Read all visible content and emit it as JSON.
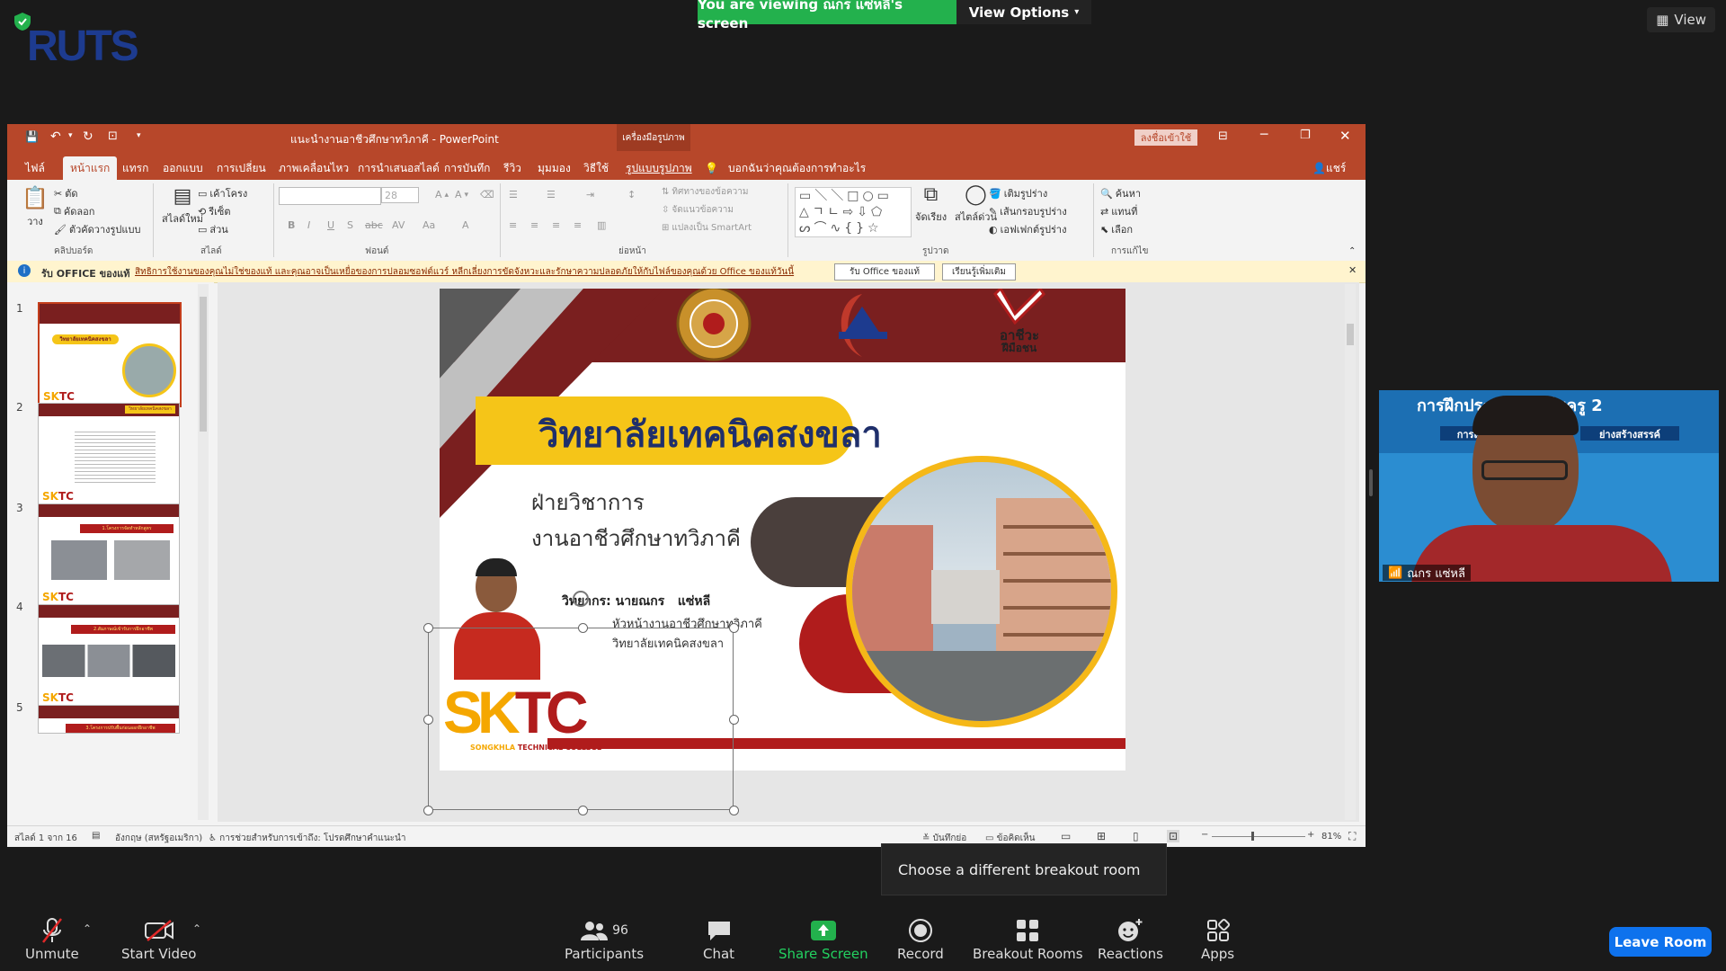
{
  "zoom": {
    "banner": "You are viewing ณกร แซ่หลี่'s screen",
    "view_options": "View Options",
    "view": "View",
    "tooltip": "Choose a different breakout room",
    "leave": "Leave Room",
    "toolbar": {
      "unmute": "Unmute",
      "start_video": "Start Video",
      "participants": "Participants",
      "participants_count": "96",
      "chat": "Chat",
      "share_screen": "Share Screen",
      "record": "Record",
      "breakout_rooms": "Breakout Rooms",
      "reactions": "Reactions",
      "apps": "Apps"
    },
    "video": {
      "name": "ณกร แซ่หลี",
      "banner_title": "การฝึกประ... วิชาชีพครู 2",
      "banner_sub1": "การแล",
      "banner_sub2": "ย่างสร้างสรรค์"
    },
    "logo_text": "RUTS"
  },
  "ppt": {
    "title": "แนะนำงานอาชีวศึกษาทวิภาคี - PowerPoint",
    "context_label": "เครื่องมือรูปภาพ",
    "signin": "ลงชื่อเข้าใช้",
    "tabs": [
      "ไฟล์",
      "หน้าแรก",
      "แทรก",
      "ออกแบบ",
      "การเปลี่ยน",
      "ภาพเคลื่อนไหว",
      "การนำเสนอสไลด์",
      "การบันทึก",
      "รีวิว",
      "มุมมอง",
      "วิธีใช้",
      "รูปแบบรูปภาพ"
    ],
    "tell_me": "บอกฉันว่าคุณต้องการทำอะไร",
    "share": "แชร์",
    "ribbon": {
      "paste": "วาง",
      "cut": "ตัด",
      "copy": "คัดลอก",
      "format_painter": "ตัวคัดวางรูปแบบ",
      "clipboard": "คลิปบอร์ด",
      "new_slide": "สไลด์ใหม่",
      "layout": "เค้าโครง",
      "reset": "รีเซ็ต",
      "section": "ส่วน",
      "slides": "สไลด์",
      "font_size": "28",
      "font": "ฟอนต์",
      "text_direction": "ทิศทางของข้อความ",
      "align_text": "จัดแนวข้อความ",
      "smartart": "แปลงเป็น SmartArt",
      "paragraph": "ย่อหน้า",
      "arrange": "จัดเรียง",
      "quick_styles": "สไตล์ด่วน",
      "shape_fill": "เติมรูปร่าง",
      "shape_outline": "เส้นกรอบรูปร่าง",
      "shape_effects": "เอฟเฟกต์รูปร่าง",
      "drawing": "รูปวาด",
      "find": "ค้นหา",
      "replace": "แทนที่",
      "select": "เลือก",
      "editing": "การแก้ไข"
    },
    "message_bar": {
      "title": "รับ OFFICE ของแท้",
      "text": "สิทธิการใช้งานของคุณไม่ใช่ของแท้ และคุณอาจเป็นเหยื่อของการปลอมซอฟต์แวร์ หลีกเลี่ยงการขัดจังหวะและรักษาความปลอดภัยให้กับไฟล์ของคุณด้วย Office ของแท้วันนี้",
      "btn1": "รับ Office ของแท้",
      "btn2": "เรียนรู้เพิ่มเติม"
    },
    "thumbs": [
      {
        "num": "1",
        "title": "วิทยาลัยเทคนิคสงขลา"
      },
      {
        "num": "2",
        "title": "วิทยาลัยเทคนิคสงขลา"
      },
      {
        "num": "3",
        "title": "1.โครงการจัดทำหลักสูตร"
      },
      {
        "num": "4",
        "title": "2.สัมภาษณ์เข้ารับการฝึกอาชีพ"
      },
      {
        "num": "5",
        "title": "3.โครงการปรับพื้นก่อนออกฝึกอาชีพ"
      }
    ],
    "status": {
      "slide_of": "สไลด์ 1 จาก 16",
      "language": "อังกฤษ (สหรัฐอเมริกา)",
      "accessibility": "การช่วยสำหรับการเข้าถึง: โปรดศึกษาคำแนะนำ",
      "notes": "บันทึกย่อ",
      "comments": "ข้อคิดเห็น",
      "zoom": "81%"
    },
    "slide": {
      "college": "วิทยาลัยเทคนิคสงขลา",
      "dept": "ฝ่ายวิชาการ",
      "work": "งานอาชีวศึกษาทวิภาคี",
      "speaker_label": "วิทยากร: นายณกร   แซ่หลี",
      "speaker_pos": "หัวหน้างานอาชีวศึกษาทวิภาคี",
      "speaker_org": "วิทยาลัยเทคนิคสงขลา",
      "logo_big": "SKTC",
      "logo_sub1": "SONGKHLA",
      "logo_sub2": "TECHNICAL COLLEGE",
      "logo3_line1": "อาชีวะ",
      "logo3_line2": "ฝีมือชน"
    }
  }
}
